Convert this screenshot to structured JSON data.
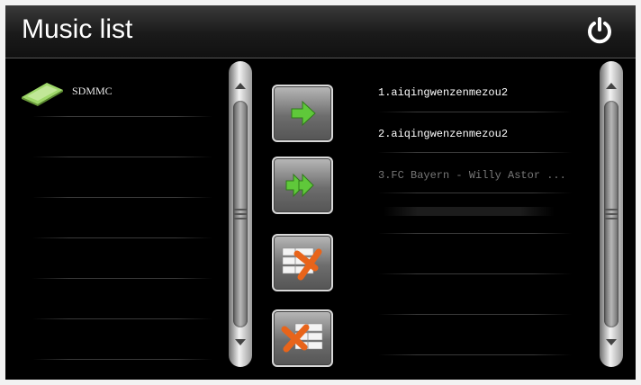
{
  "header": {
    "title": "Music list",
    "power_icon": "power-icon"
  },
  "source_list": {
    "items": [
      {
        "label": "SDMMC",
        "icon": "sd-card-icon"
      }
    ]
  },
  "actions": [
    {
      "name": "add-selected-button",
      "icon": "arrow-right-icon"
    },
    {
      "name": "add-all-button",
      "icon": "double-arrow-right-icon"
    },
    {
      "name": "remove-selected-button",
      "icon": "remove-from-list-icon"
    },
    {
      "name": "clear-list-button",
      "icon": "clear-list-icon"
    }
  ],
  "playlist": {
    "songs": [
      {
        "label": "1.aiqingwenzenmezou2"
      },
      {
        "label": "2.aiqingwenzenmezou2"
      },
      {
        "label": "3.FC Bayern - Willy Astor ..."
      }
    ]
  },
  "colors": {
    "accent_green": "#5fc83a",
    "accent_orange": "#e8641a",
    "text_active": "#ffffff",
    "text_dim": "#777777"
  }
}
